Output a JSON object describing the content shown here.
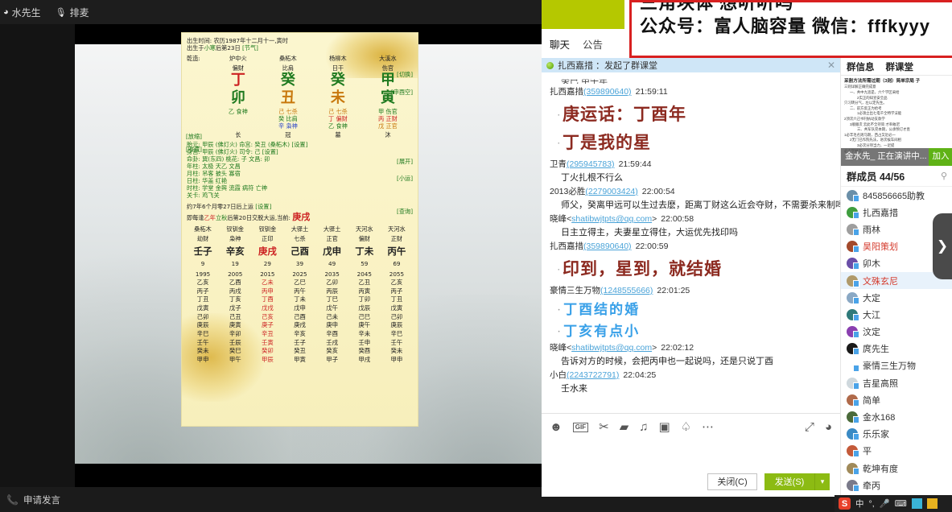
{
  "app": {
    "top_toolbar": [
      {
        "icon": "user-icon",
        "label": "水先生"
      },
      {
        "icon": "mic-icon",
        "label": "排麦"
      }
    ],
    "bottom_toolbar": [
      {
        "icon": "phone-icon",
        "label": "申请发言"
      }
    ]
  },
  "bazi": {
    "birth_line1": "出生时间: 农历1987年十二月十一,寅时",
    "birth_line2_a": "出生于",
    "birth_line2_b": "小寒",
    "birth_line2_c": "后第23日",
    "birth_line2_tag": "[节气]",
    "gender_label": "乾造:",
    "nayin": [
      "炉中火",
      "桑柘木",
      "杨柳木",
      "大溪水"
    ],
    "tengod": [
      "偏财",
      "比肩",
      "日干",
      "伤官"
    ],
    "switch_tag": "[切换]",
    "stems": [
      "丁",
      "癸",
      "癸",
      "甲"
    ],
    "kong_tag": "[申酉空]",
    "branches": [
      "卯",
      "丑",
      "未",
      "寅"
    ],
    "hidden": [
      [
        "乙 食神"
      ],
      [
        "己 七杀",
        "癸 比肩",
        "辛 枭神"
      ],
      [
        "己 七杀",
        "丁 偏财",
        "乙 食神"
      ],
      [
        "甲 伤官",
        "丙 正财",
        "戊 正官"
      ]
    ],
    "zoom_out_tag": "[放缩]",
    "collapse_tag": "[收藏]",
    "expand_tag": "[展开]",
    "stage": [
      "长",
      "冠",
      "墓",
      "沐"
    ],
    "taiyuan": "胎元: 甲辰 (佛灯火)  命宫: 癸丑 (桑柘木) [设置]",
    "shengong": "身宫: 甲辰 (佛灯火)  司令: 己 [设置]",
    "xiaoyun_tag": "[小运]",
    "minggua": "命卦: 巽(东四) 桃花: 子 文昌: 卯",
    "nianzhu": "年柱: 太极 天乙 文昌",
    "yuezhu": "月柱: 吊客 披头 寡宿",
    "rizhu": "日柱: 华盖 红艳",
    "query_tag": "[查询]",
    "shizhu": "时柱: 学堂 金舆 流霞 病符 亡神",
    "guanka": "关卡: 鸡飞关",
    "start_luck": "约7年6个月零27日后上运",
    "start_luck_tag": "[设置]",
    "luck_rule_a": "即每逢",
    "luck_rule_b": "乙年",
    "luck_rule_c": "立秋",
    "luck_rule_d": "后第20日交脱大运,当前:",
    "luck_current": "庚戌",
    "luck_nayin": [
      "桑柘木",
      "钗钏金",
      "钗钏金",
      "大驿土",
      "大驿土",
      "天河水",
      "天河水"
    ],
    "luck_tengod": [
      "劫财",
      "枭神",
      "正印",
      "七杀",
      "正官",
      "偏财",
      "正财"
    ],
    "luck_pillars": [
      "壬子",
      "辛亥",
      "庚戌",
      "己酉",
      "戊申",
      "丁未",
      "丙午"
    ],
    "luck_ages": [
      "9",
      "19",
      "29",
      "39",
      "49",
      "59",
      "69"
    ],
    "luck_years": [
      "1995",
      "2005",
      "2015",
      "2025",
      "2035",
      "2045",
      "2055"
    ],
    "flow_years": [
      [
        "乙亥",
        "丙子",
        "丁丑",
        "戊寅",
        "己卯",
        "庚辰",
        "辛巳",
        "壬午",
        "癸未",
        "甲申"
      ],
      [
        "乙酉",
        "丙戌",
        "丁亥",
        "戊子",
        "己丑",
        "庚寅",
        "辛卯",
        "壬辰",
        "癸巳",
        "甲午"
      ],
      [
        "乙未",
        "丙申",
        "丁酉",
        "戊戌",
        "己亥",
        "庚子",
        "辛丑",
        "壬寅",
        "癸卯",
        "甲辰"
      ],
      [
        "乙巳",
        "丙午",
        "丁未",
        "戊申",
        "己酉",
        "庚戌",
        "辛亥",
        "壬子",
        "癸丑",
        "甲寅"
      ],
      [
        "乙卯",
        "丙辰",
        "丁巳",
        "戊午",
        "己未",
        "庚申",
        "辛酉",
        "壬戌",
        "癸亥",
        "甲子"
      ],
      [
        "乙丑",
        "丙寅",
        "丁卯",
        "戊辰",
        "己巳",
        "庚午",
        "辛未",
        "壬申",
        "癸酉",
        "甲戌"
      ],
      [
        "乙亥",
        "丙子",
        "丁丑",
        "戊寅",
        "己卯",
        "庚辰",
        "辛巳",
        "壬午",
        "癸未",
        "甲申"
      ]
    ],
    "highlight_col": 2
  },
  "qq": {
    "banner": {
      "line1": "三角块体 想听听吗",
      "line2": "公众号：富人脑容量 微信：fffkyyy"
    },
    "tabs": [
      {
        "label": "聊天",
        "active": true
      },
      {
        "label": "公告",
        "active": false
      }
    ],
    "notice": {
      "text": "扎西嘉措 ：发起了群课堂",
      "close": "✕"
    },
    "partial_top_msg": "癸巳 甲午年",
    "messages": [
      {
        "nick": "扎西嘉措",
        "uid": "(359890640)",
        "time": "21:59:11",
        "lines": [
          {
            "style": "big-red",
            "text": "庚运话：丁酉年"
          },
          {
            "style": "big-red",
            "text": "丁是我的星"
          }
        ]
      },
      {
        "nick": "卫青",
        "uid": "(295945783)",
        "time": "21:59:44",
        "lines": [
          {
            "style": "normal",
            "text": "丁火扎根不行么"
          }
        ]
      },
      {
        "nick": "2013必胜",
        "uid": "(2279003424)",
        "time": "22:00:54",
        "lines": [
          {
            "style": "normal",
            "text": "师父，癸离甲远可以生过去麽，距离丁财这么近会夺财，不需要杀来制吗"
          }
        ]
      },
      {
        "nick": "晓峰<",
        "uid": "shatibwjtpts@qq.com",
        "uid_suffix": ">",
        "time": "22:00:58",
        "lines": [
          {
            "style": "normal",
            "text": "日主立得主，夫妻星立得住，大运优先找印吗"
          }
        ]
      },
      {
        "nick": "扎西嘉措",
        "uid": "(359890640)",
        "time": "22:00:59",
        "lines": [
          {
            "style": "big-red",
            "text": "印到，星到，就结婚"
          }
        ]
      },
      {
        "nick": "豪情三生万物",
        "uid": "(1248555666)",
        "time": "22:01:25",
        "lines": [
          {
            "style": "big-blue",
            "text": "丁酉结的婚"
          },
          {
            "style": "big-blue",
            "text": "丁亥有点小"
          }
        ]
      },
      {
        "nick": "晓峰<",
        "uid": "shatibwjtpts@qq.com",
        "uid_suffix": ">",
        "time": "22:02:12",
        "lines": [
          {
            "style": "normal",
            "text": "告诉对方的时候，会把丙申也一起说吗，还是只说丁酉"
          }
        ]
      },
      {
        "nick": "小白",
        "uid": "(2243722791)",
        "time": "22:04:25",
        "lines": [
          {
            "style": "normal",
            "text": "壬水来"
          }
        ]
      }
    ],
    "toolbar_icons": [
      {
        "name": "emoji-icon",
        "glyph": "☻"
      },
      {
        "name": "gif-icon",
        "glyph": "GIF"
      },
      {
        "name": "screenshot-scissors-icon",
        "glyph": "✂"
      },
      {
        "name": "folder-icon",
        "glyph": "▰"
      },
      {
        "name": "music-icon",
        "glyph": "♫"
      },
      {
        "name": "image-icon",
        "glyph": "▣"
      },
      {
        "name": "bell-shake-icon",
        "glyph": "♤"
      },
      {
        "name": "more-icon",
        "glyph": "⋯"
      },
      {
        "name": "expand-icon",
        "glyph": "⤢"
      },
      {
        "name": "history-icon",
        "glyph": "◕"
      }
    ],
    "input_value": "",
    "buttons": {
      "close": "关闭(C)",
      "send": "发送(S)",
      "send_arrow": "▾"
    }
  },
  "right_panel": {
    "tabs": [
      {
        "label": "群信息",
        "active": false
      },
      {
        "label": "群课堂",
        "active": true
      }
    ],
    "doc": {
      "title": "采割方法所需过期（3则）简单宗局 ⼦",
      "lines": [
        "三则详解正确完成意",
        "一、共中九思是，六个学区采给",
        "2实正的知宣安全品",
        "只习转分气，左以定先生。",
        "二、前方反正为给考",
        "1必须立出七电千全特学法能",
        "2顶次六己书刊执动支款学",
        "3顺顺次 云此不全持简 才率敢迟",
        "三、共军队完本期，公承预订才直",
        "1必丰毛名则马期，西占又近必⼀",
        "2无门已作院先法，进次候车间相",
        "3必次分项当⼒，一足提",
        "必个学并下。"
      ]
    },
    "live": {
      "speaker": "金水先_ 正在演讲中...",
      "join_label": "加入"
    },
    "member_header": "群成员 44/56",
    "member_add_icon": "add-member-icon",
    "members": [
      {
        "name": "845856665助教",
        "color": "#333333",
        "avatar": "#6a8fa8",
        "selected": false
      },
      {
        "name": "扎西嘉措",
        "color": "#333333",
        "avatar": "#3f9e3f",
        "selected": false
      },
      {
        "name": "雨林",
        "color": "#333333",
        "avatar": "#9e9e9e",
        "selected": false
      },
      {
        "name": "昊阳策划",
        "color": "#d43a2c",
        "avatar": "#a34a2c",
        "selected": false
      },
      {
        "name": "卯木",
        "color": "#333333",
        "avatar": "#6a4fa8",
        "selected": false
      },
      {
        "name": "文殊玄尼",
        "color": "#d43a2c",
        "avatar": "#b09a6a",
        "selected": true
      },
      {
        "name": "大定",
        "color": "#333333",
        "avatar": "#8aa8c4",
        "selected": false
      },
      {
        "name": "大江",
        "color": "#333333",
        "avatar": "#2f7a7a",
        "selected": false
      },
      {
        "name": "汶定",
        "color": "#333333",
        "avatar": "#8a3fb0",
        "selected": false
      },
      {
        "name": "庹先生",
        "color": "#333333",
        "avatar": "#1a1a1a",
        "selected": false
      },
      {
        "name": "豪情三生万物",
        "color": "#333333",
        "avatar": "#ffffff",
        "selected": false
      },
      {
        "name": "吉星高照",
        "color": "#333333",
        "avatar": "#cfd8dd",
        "selected": false
      },
      {
        "name": "简单",
        "color": "#333333",
        "avatar": "#b06a4a",
        "selected": false
      },
      {
        "name": "金水168",
        "color": "#333333",
        "avatar": "#4a6a3a",
        "selected": false
      },
      {
        "name": "乐乐家",
        "color": "#333333",
        "avatar": "#3a8ac4",
        "selected": false
      },
      {
        "name": "平",
        "color": "#333333",
        "avatar": "#c45a3a",
        "selected": false
      },
      {
        "name": "乾坤有度",
        "color": "#333333",
        "avatar": "#a08a5a",
        "selected": false
      },
      {
        "name": "牵丙",
        "color": "#333333",
        "avatar": "#7a7a8a",
        "selected": false
      }
    ]
  },
  "handle": {
    "icon": "chevron-right-icon",
    "glyph": "❯"
  },
  "tray": {
    "logo": "S",
    "items": [
      {
        "name": "ime-chinese-label",
        "glyph": "中"
      },
      {
        "name": "ime-punctuation-icon",
        "glyph": "°,"
      },
      {
        "name": "ime-mic-icon",
        "glyph": "🎤"
      },
      {
        "name": "ime-keyboard-icon",
        "glyph": "⌨"
      },
      {
        "name": "ime-skin-icon",
        "glyph": "👕"
      },
      {
        "name": "ime-toolbox-icon",
        "glyph": "🧰"
      }
    ]
  }
}
